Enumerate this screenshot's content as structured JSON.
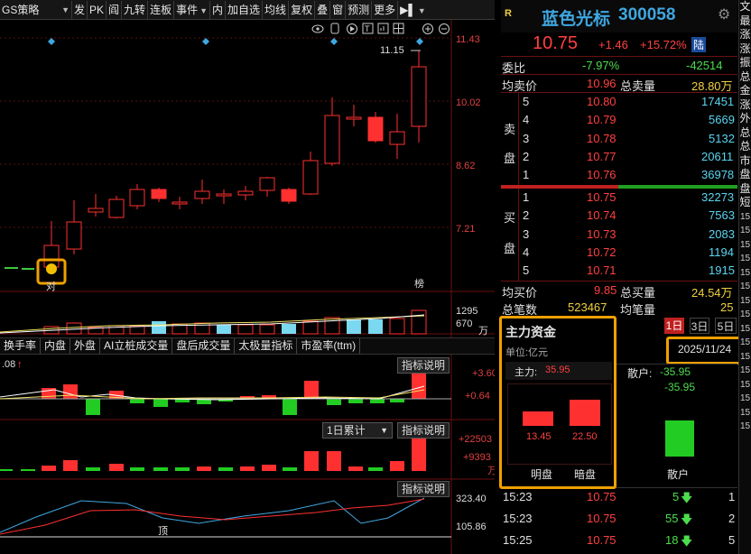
{
  "toolbar": {
    "strategy": "GS策略",
    "items": [
      "发",
      "PK",
      "阎",
      "九转",
      "连板",
      "事件",
      "内",
      "加自选",
      "均线",
      "复权",
      "叠",
      "窗",
      "预测",
      "更多"
    ]
  },
  "chart": {
    "price_labels": [
      "11.43",
      "10.02",
      "8.62",
      "7.21"
    ],
    "high_label": "11.15",
    "vol_labels": [
      "1295",
      "670"
    ],
    "vol_unit": "万",
    "ind1_labels": [
      "+3.60",
      "+0.64"
    ],
    "ind1_left": ".08",
    "ind2_labels": [
      "+22503",
      "+9393"
    ],
    "ind2_unit": "万",
    "ind3_labels": [
      "323.40",
      "105.86"
    ],
    "ind3_note": "顶",
    "bang_label": "榜",
    "dui_label": "对",
    "accum_select": "1日累计",
    "explain_label": "指标说明"
  },
  "indicator_tabs": [
    "换手率",
    "内盘",
    "外盘",
    "AI立桩成交量",
    "盘后成交量",
    "太极量指标",
    "市盈率(ttm)"
  ],
  "stock": {
    "badge": "R",
    "name": "蓝色光标",
    "code": "300058",
    "price": "10.75",
    "change": "+1.46",
    "change_pct": "+15.72%",
    "market_tag": "陆"
  },
  "order_book": {
    "weibi_label": "委比",
    "weibi_pct": "-7.97%",
    "weibi_val": "-42514",
    "avg_sell_label": "均卖价",
    "avg_sell": "10.96",
    "total_sell_label": "总卖量",
    "total_sell": "28.80万",
    "sell_side_label": [
      "卖",
      "盘"
    ],
    "sells": [
      {
        "lvl": "5",
        "price": "10.80",
        "vol": "17451"
      },
      {
        "lvl": "4",
        "price": "10.79",
        "vol": "5669"
      },
      {
        "lvl": "3",
        "price": "10.78",
        "vol": "5132"
      },
      {
        "lvl": "2",
        "price": "10.77",
        "vol": "20611"
      },
      {
        "lvl": "1",
        "price": "10.76",
        "vol": "36978"
      }
    ],
    "buy_side_label": [
      "买",
      "盘"
    ],
    "buys": [
      {
        "lvl": "1",
        "price": "10.75",
        "vol": "32273"
      },
      {
        "lvl": "2",
        "price": "10.74",
        "vol": "7563"
      },
      {
        "lvl": "3",
        "price": "10.73",
        "vol": "2083"
      },
      {
        "lvl": "4",
        "price": "10.72",
        "vol": "1194"
      },
      {
        "lvl": "5",
        "price": "10.71",
        "vol": "1915"
      }
    ],
    "avg_buy_label": "均买价",
    "avg_buy": "9.85",
    "total_buy_label": "总买量",
    "total_buy": "24.54万",
    "total_count_label": "总笔数",
    "total_count": "523467",
    "avg_lot_label": "均笔量",
    "avg_lot": "25"
  },
  "fund_flow": {
    "title": "主力资金",
    "unit": "单位:亿元",
    "tabs": [
      "1日",
      "3日",
      "5日"
    ],
    "date": "2025/11/24",
    "main_label": "主力:",
    "main_val": "35.95",
    "retail_label": "散户:",
    "retail_val": "-35.95",
    "retail_bar_val": "-35.95",
    "ming_val": "13.45",
    "an_val": "22.50",
    "ming_label": "明盘",
    "an_label": "暗盘",
    "retail_bar_label": "散户"
  },
  "ticks": [
    {
      "time": "15:23",
      "price": "10.75",
      "vol": "5",
      "n": "1"
    },
    {
      "time": "15:23",
      "price": "10.75",
      "vol": "55",
      "n": "2"
    },
    {
      "time": "15:25",
      "price": "10.75",
      "vol": "18",
      "n": "5"
    }
  ],
  "vertical_tabs": [
    "文",
    "最",
    "涨",
    "涨",
    "振",
    "总",
    "金",
    "涨",
    "外",
    "总",
    "总",
    "市",
    "盘",
    "盘",
    "短",
    "15",
    "15",
    "15",
    "15",
    "15",
    "15",
    "15",
    "15",
    "15",
    "15",
    "15",
    "15",
    "15",
    "15",
    "15",
    "15"
  ]
}
